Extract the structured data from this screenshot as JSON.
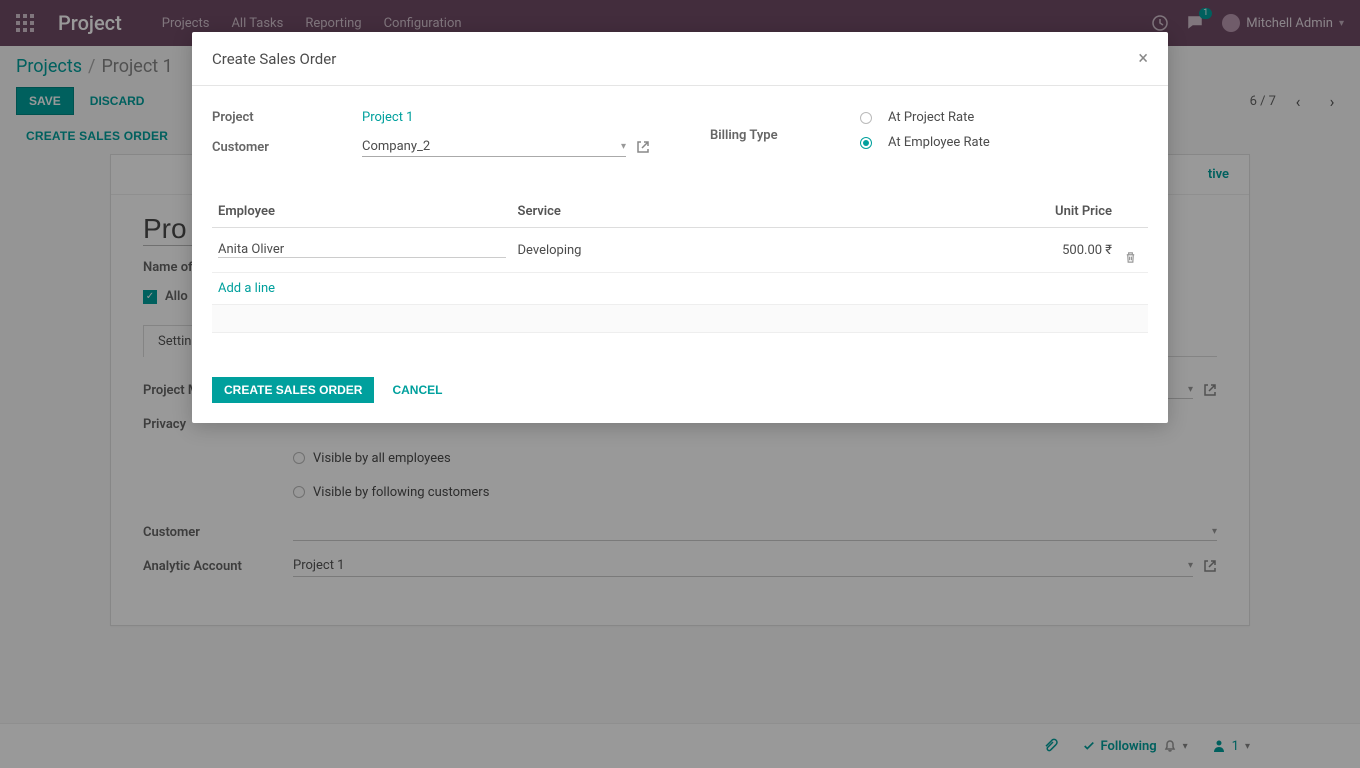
{
  "colors": {
    "primary": "#00A09D",
    "navbar": "#714B67"
  },
  "topnav": {
    "brand": "Project",
    "menu": [
      "Projects",
      "All Tasks",
      "Reporting",
      "Configuration"
    ],
    "chat_badge": "1",
    "user_name": "Mitchell Admin"
  },
  "breadcrumb": {
    "root": "Projects",
    "current": "Project 1"
  },
  "actions": {
    "save": "SAVE",
    "discard": "DISCARD",
    "create_sales_order": "CREATE SALES ORDER"
  },
  "pager": {
    "text": "6 / 7"
  },
  "sheet": {
    "status_right": "tive",
    "title_value": "Pro",
    "name_label": "Name of",
    "allow_label": "Allo",
    "tab": "Settin",
    "project_m_label": "Project M",
    "privacy_label": "Privacy",
    "visible_all": "Visible by all employees",
    "visible_following": "Visible by following customers",
    "customer_label": "Customer",
    "analytic_label": "Analytic Account",
    "analytic_value": "Project 1"
  },
  "followbar": {
    "following": "Following",
    "followers_count": "1"
  },
  "modal": {
    "title": "Create Sales Order",
    "project_label": "Project",
    "project_value": "Project 1",
    "customer_label": "Customer",
    "customer_value": "Company_2",
    "billing_type_label": "Billing Type",
    "radio_project_rate": "At Project Rate",
    "radio_employee_rate": "At Employee Rate",
    "table": {
      "col_employee": "Employee",
      "col_service": "Service",
      "col_unit_price": "Unit Price",
      "rows": [
        {
          "employee": "Anita Oliver",
          "service": "Developing",
          "unit_price": "500.00 ₹"
        }
      ],
      "add_line": "Add a line"
    },
    "footer": {
      "primary": "CREATE SALES ORDER",
      "cancel": "CANCEL"
    }
  }
}
